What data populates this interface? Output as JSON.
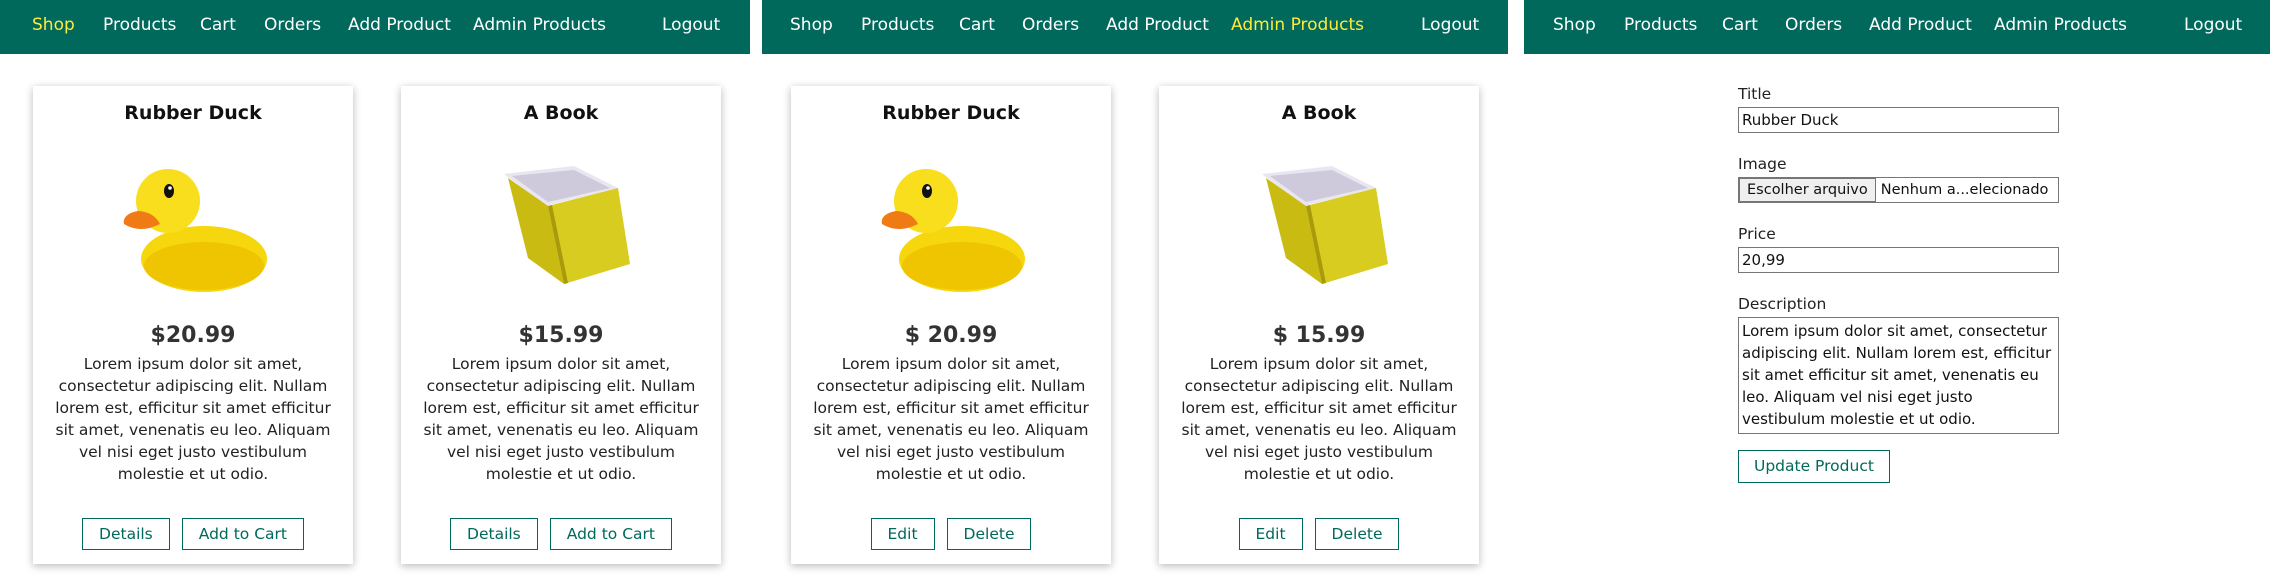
{
  "colors": {
    "nav_bg": "#00695c",
    "nav_text": "#ffffff",
    "nav_active": "#ffeb3b",
    "accent": "#00695c",
    "duck": "#f6d70e",
    "book": "#d9cc21"
  },
  "panels": [
    {
      "nav": {
        "shop": "Shop",
        "products": "Products",
        "cart": "Cart",
        "orders": "Orders",
        "add_product": "Add Product",
        "admin_products": "Admin Products",
        "logout": "Logout",
        "active": "shop"
      },
      "products": [
        {
          "title": "Rubber Duck",
          "image_icon": "rubber-duck-icon",
          "price": "$20.99",
          "description": "Lorem ipsum dolor sit amet, consectetur adipiscing elit. Nullam lorem est, efficitur sit amet efficitur sit amet, venenatis eu leo. Aliquam vel nisi eget justo vestibulum molestie et ut odio.",
          "actions": [
            "Details",
            "Add to Cart"
          ]
        },
        {
          "title": "A Book",
          "image_icon": "book-icon",
          "price": "$15.99",
          "description": "Lorem ipsum dolor sit amet, consectetur adipiscing elit. Nullam lorem est, efficitur sit amet efficitur sit amet, venenatis eu leo. Aliquam vel nisi eget justo vestibulum molestie et ut odio.",
          "actions": [
            "Details",
            "Add to Cart"
          ]
        }
      ]
    },
    {
      "nav": {
        "shop": "Shop",
        "products": "Products",
        "cart": "Cart",
        "orders": "Orders",
        "add_product": "Add Product",
        "admin_products": "Admin Products",
        "logout": "Logout",
        "active": "admin_products"
      },
      "products": [
        {
          "title": "Rubber Duck",
          "image_icon": "rubber-duck-icon",
          "price": "$ 20.99",
          "description": "Lorem ipsum dolor sit amet, consectetur adipiscing elit. Nullam lorem est, efficitur sit amet efficitur sit amet, venenatis eu leo. Aliquam vel nisi eget justo vestibulum molestie et ut odio.",
          "actions": [
            "Edit",
            "Delete"
          ]
        },
        {
          "title": "A Book",
          "image_icon": "book-icon",
          "price": "$ 15.99",
          "description": "Lorem ipsum dolor sit amet, consectetur adipiscing elit. Nullam lorem est, efficitur sit amet efficitur sit amet, venenatis eu leo. Aliquam vel nisi eget justo vestibulum molestie et ut odio.",
          "actions": [
            "Edit",
            "Delete"
          ]
        }
      ]
    },
    {
      "nav": {
        "shop": "Shop",
        "products": "Products",
        "cart": "Cart",
        "orders": "Orders",
        "add_product": "Add Product",
        "admin_products": "Admin Products",
        "logout": "Logout",
        "active": ""
      },
      "form": {
        "title_label": "Title",
        "title_value": "Rubber Duck",
        "image_label": "Image",
        "file_button": "Escolher arquivo",
        "file_status": "Nenhum a...elecionado",
        "price_label": "Price",
        "price_value": "20,99",
        "description_label": "Description",
        "description_value": "Lorem ipsum dolor sit amet, consectetur adipiscing elit. Nullam lorem est, efficitur sit amet efficitur sit amet, venenatis eu leo. Aliquam vel nisi eget justo vestibulum molestie et ut odio.",
        "submit_label": "Update Product"
      }
    }
  ]
}
